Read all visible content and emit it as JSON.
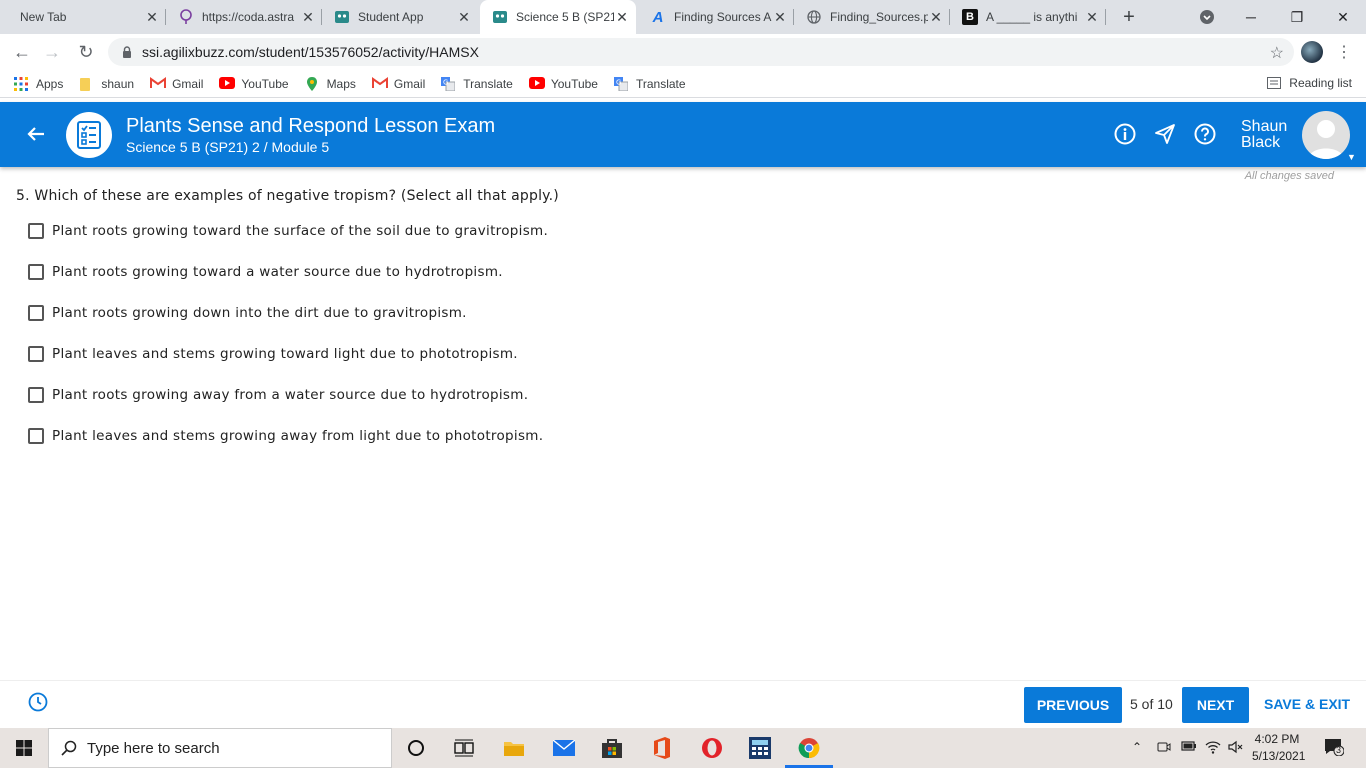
{
  "browser": {
    "tabs": [
      {
        "title": "New Tab",
        "favicon": "none"
      },
      {
        "title": "https://coda.astra",
        "favicon": "bulb-icon"
      },
      {
        "title": "Student App",
        "favicon": "student-app-icon"
      },
      {
        "title": "Science 5 B (SP21",
        "favicon": "student-app-icon"
      },
      {
        "title": "Finding Sources A",
        "favicon": "script-a-icon"
      },
      {
        "title": "Finding_Sources.p",
        "favicon": "globe-icon"
      },
      {
        "title": "A _____ is anythi",
        "favicon": "brainly-icon"
      }
    ],
    "url": "ssi.agilixbuzz.com/student/153576052/activity/HAMSX",
    "bookmarks": [
      {
        "label": "Apps",
        "icon": "apps-grid-icon"
      },
      {
        "label": "shaun",
        "icon": "folder-icon"
      },
      {
        "label": "Gmail",
        "icon": "gmail-icon"
      },
      {
        "label": "YouTube",
        "icon": "youtube-icon"
      },
      {
        "label": "Maps",
        "icon": "maps-icon"
      },
      {
        "label": "Gmail",
        "icon": "gmail-icon"
      },
      {
        "label": "Translate",
        "icon": "translate-icon"
      },
      {
        "label": "YouTube",
        "icon": "youtube-icon"
      },
      {
        "label": "Translate",
        "icon": "translate-icon"
      }
    ],
    "reading_list": "Reading list"
  },
  "header": {
    "title": "Plants Sense and Respond Lesson Exam",
    "subtitle": "Science 5 B (SP21) 2 / Module 5",
    "user_name_first": "Shaun",
    "user_name_last": "Black",
    "accent": "#0a7ad9"
  },
  "status": {
    "saved": "All changes saved"
  },
  "question": {
    "text": "5. Which of these are examples of negative tropism? (Select all that apply.)",
    "options": [
      {
        "label": "Plant roots growing toward the surface of the soil due to gravitropism.",
        "checked": false
      },
      {
        "label": "Plant roots growing toward a water source due to hydrotropism.",
        "checked": false
      },
      {
        "label": "Plant roots growing down into the dirt due to gravitropism.",
        "checked": false
      },
      {
        "label": "Plant leaves and stems growing toward light due to phototropism.",
        "checked": false
      },
      {
        "label": "Plant roots growing away from a water source due to hydrotropism.",
        "checked": false
      },
      {
        "label": "Plant leaves and stems growing away from light due to phototropism.",
        "checked": false
      }
    ]
  },
  "footer": {
    "previous": "PREVIOUS",
    "page_count": "5 of 10",
    "next": "NEXT",
    "save_exit": "SAVE & EXIT"
  },
  "taskbar": {
    "search_placeholder": "Type here to search",
    "time": "4:02 PM",
    "date": "5/13/2021",
    "notifications": "3"
  }
}
